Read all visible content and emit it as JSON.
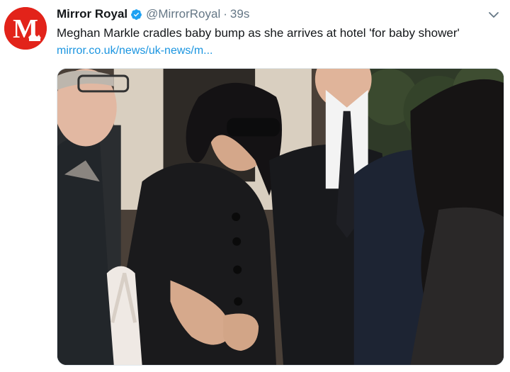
{
  "tweet": {
    "display_name": "Mirror Royal",
    "handle": "@MirrorRoyal",
    "separator": "·",
    "time": "39s",
    "text": "Meghan Markle cradles baby bump as she arrives at hotel 'for baby shower'",
    "link": "mirror.co.uk/news/uk-news/m...",
    "avatar_letter": "M",
    "icons": {
      "verified": "verified-badge-icon",
      "more": "chevron-down-icon"
    }
  },
  "colors": {
    "avatar_bg": "#e2231a",
    "link": "#1b95e0",
    "verified": "#1da1f2",
    "secondary_text": "#657786"
  }
}
